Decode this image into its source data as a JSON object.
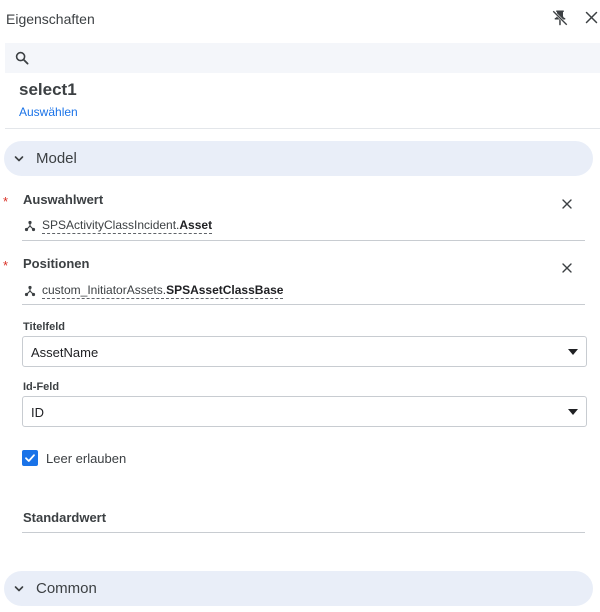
{
  "header": {
    "title": "Eigenschaften",
    "pin_icon": "unpin-icon",
    "close_icon": "close-icon"
  },
  "search": {
    "icon": "search-icon",
    "value": "",
    "placeholder": ""
  },
  "component": {
    "name": "select1",
    "select_link": "Auswählen"
  },
  "sections": {
    "model": {
      "label": "Model",
      "expanded": true
    },
    "common": {
      "label": "Common",
      "expanded": false
    }
  },
  "properties": {
    "auswahlwert": {
      "label": "Auswahlwert",
      "required_mark": "*",
      "binding_source": "SPSActivityClassIncident.",
      "binding_field": "Asset"
    },
    "positionen": {
      "label": "Positionen",
      "required_mark": "*",
      "binding_source": "custom_InitiatorAssets.",
      "binding_field": "SPSAssetClassBase"
    },
    "titelfeld": {
      "label": "Titelfeld",
      "value": "AssetName"
    },
    "idfeld": {
      "label": "Id-Feld",
      "value": "ID"
    },
    "leer_erlauben": {
      "label": "Leer erlauben",
      "checked": true
    },
    "standardwert": {
      "label": "Standardwert"
    }
  },
  "colors": {
    "accent": "#1a73e8",
    "section_bg": "#e9eef8",
    "required": "#d93025",
    "search_bg": "#f4f6fa"
  }
}
